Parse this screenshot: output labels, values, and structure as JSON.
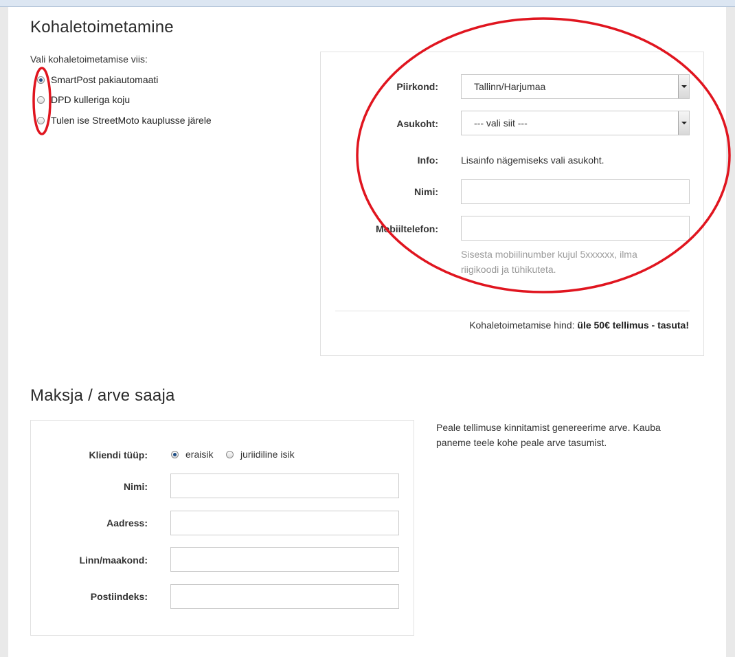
{
  "delivery": {
    "title": "Kohaletoimetamine",
    "choose_label": "Vali kohaletoimetamise viis:",
    "options": [
      {
        "label": "SmartPost pakiautomaati",
        "checked": true
      },
      {
        "label": "DPD kulleriga koju",
        "checked": false
      },
      {
        "label": "Tulen ise StreetMoto kauplusse järele",
        "checked": false
      }
    ],
    "form": {
      "region_label": "Piirkond:",
      "region_value": "Tallinn/Harjumaa",
      "location_label": "Asukoht:",
      "location_value": "--- vali siit ---",
      "info_label": "Info:",
      "info_value": "Lisainfo nägemiseks vali asukoht.",
      "name_label": "Nimi:",
      "phone_label": "Mobiiltelefon:",
      "phone_hint_1": "Sisesta mobiilinumber kujul 5xxxxxx, ilma",
      "phone_hint_2": "riigikoodi ja tühikuteta."
    },
    "price_label": "Kohaletoimetamise hind:",
    "price_value": "üle 50€ tellimus - tasuta!"
  },
  "payer": {
    "title": "Maksja / arve saaja",
    "client_type_label": "Kliendi tüüp:",
    "client_types": [
      {
        "label": "eraisik",
        "checked": true
      },
      {
        "label": "juriidiline isik",
        "checked": false
      }
    ],
    "name_label": "Nimi:",
    "address_label": "Aadress:",
    "city_label": "Linn/maakond:",
    "postal_label": "Postiindeks:",
    "info_line_1": "Peale tellimuse kinnitamist genereerime arve. Kauba",
    "info_line_2": "paneme teele kohe peale arve tasumist."
  },
  "annotation_color": "#e0151f"
}
